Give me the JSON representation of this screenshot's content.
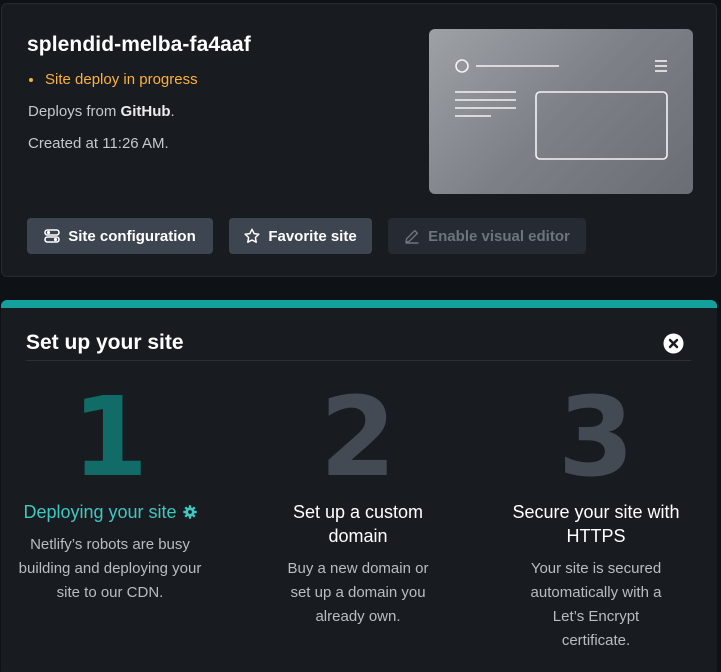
{
  "site": {
    "name": "splendid-melba-fa4aaf",
    "status": "Site deploy in progress",
    "deploys_prefix": "Deploys from ",
    "deploys_source": "GitHub",
    "deploys_suffix": ".",
    "created": "Created at 11:26 AM."
  },
  "actions": {
    "site_configuration": "Site configuration",
    "favorite_site": "Favorite site",
    "enable_visual_editor": "Enable visual editor"
  },
  "setup": {
    "title": "Set up your site",
    "steps": [
      {
        "number": "1",
        "title": "Deploying your site",
        "description": "Netlify’s robots are busy building and deploying your site to our CDN.",
        "icon": "gear-icon",
        "active": true
      },
      {
        "number": "2",
        "title": "Set up a custom domain",
        "description": "Buy a new domain or set up a domain you already own."
      },
      {
        "number": "3",
        "title": "Secure your site with HTTPS",
        "description": "Your site is secured automatically with a Let’s Encrypt certificate."
      }
    ]
  },
  "colors": {
    "accent": "#14a19d",
    "status_warning": "#fbb13d",
    "active_step": "#3fc7c0"
  }
}
